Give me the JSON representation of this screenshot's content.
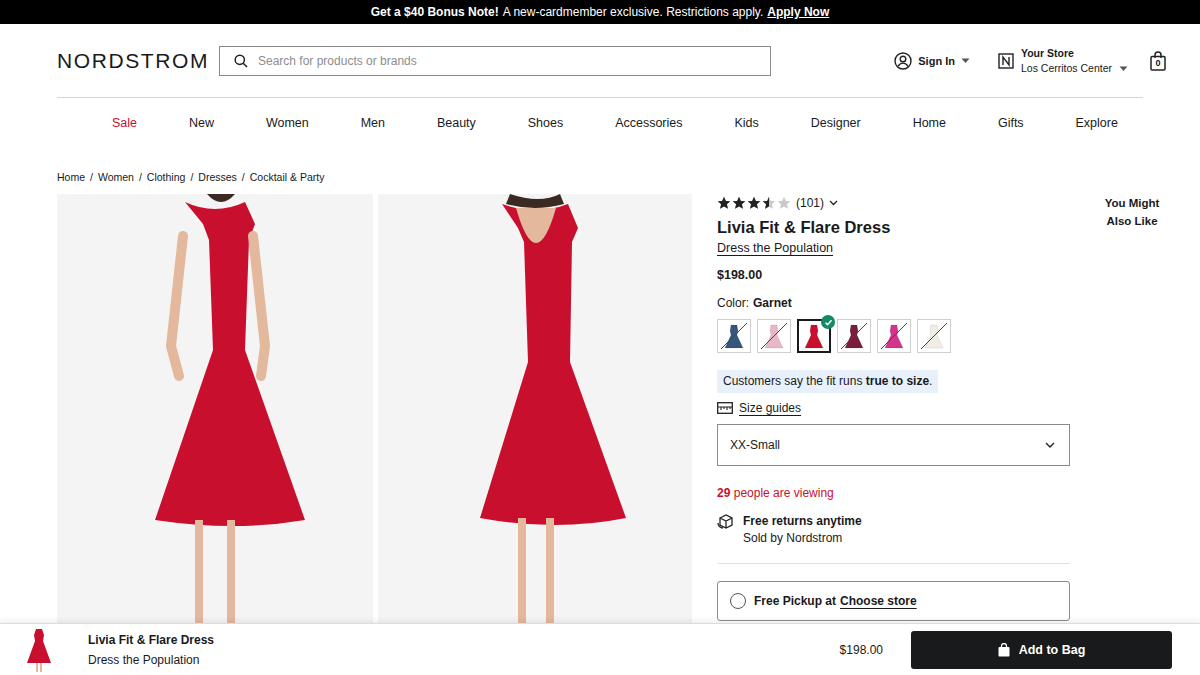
{
  "promo": {
    "headline": "Get a $40 Bonus Note!",
    "text": "A new-cardmember exclusive. Restrictions apply.",
    "link": "Apply Now"
  },
  "header": {
    "logo": "NORDSTROM",
    "search_placeholder": "Search for products or brands",
    "sign_in": "Sign In",
    "store_label": "Your Store",
    "store_name": "Los Cerritos Center",
    "bag_count": "0"
  },
  "nav": [
    {
      "label": "Sale",
      "highlight": true
    },
    {
      "label": "New",
      "highlight": false
    },
    {
      "label": "Women",
      "highlight": false
    },
    {
      "label": "Men",
      "highlight": false
    },
    {
      "label": "Beauty",
      "highlight": false
    },
    {
      "label": "Shoes",
      "highlight": false
    },
    {
      "label": "Accessories",
      "highlight": false
    },
    {
      "label": "Kids",
      "highlight": false
    },
    {
      "label": "Designer",
      "highlight": false
    },
    {
      "label": "Home",
      "highlight": false
    },
    {
      "label": "Gifts",
      "highlight": false
    },
    {
      "label": "Explore",
      "highlight": false
    }
  ],
  "breadcrumb": {
    "items": [
      "Home",
      "Women",
      "Clothing",
      "Dresses",
      "Cocktail & Party"
    ],
    "separator": "/"
  },
  "product": {
    "rating": {
      "stars": 3.5,
      "count": "(101)"
    },
    "title": "Livia Fit & Flare Dress",
    "brand": "Dress the Population",
    "price": "$198.00",
    "color_label": "Color:",
    "color_name": "Garnet",
    "swatches": [
      {
        "color": "#35577a",
        "selected": false,
        "available": false
      },
      {
        "color": "#e9b7c9",
        "selected": false,
        "available": false
      },
      {
        "color": "#c8102e",
        "selected": true,
        "available": true
      },
      {
        "color": "#7a1e3e",
        "selected": false,
        "available": false
      },
      {
        "color": "#d4358c",
        "selected": false,
        "available": false
      },
      {
        "color": "#f1ede4",
        "selected": false,
        "available": false
      }
    ],
    "fit_note": {
      "prefix": "Customers say the fit runs",
      "emphasis": "true to size",
      "suffix": "."
    },
    "size_guides": "Size guides",
    "size_value": "XX-Small",
    "viewing": {
      "count": "29",
      "text": "people are viewing"
    },
    "returns": {
      "title": "Free returns anytime",
      "subtitle": "Sold by Nordstrom"
    },
    "pickup": {
      "prefix": "Free Pickup at",
      "link": "Choose store",
      "selected": false
    }
  },
  "recommendations": {
    "title": "You Might Also Like"
  },
  "sticky_bar": {
    "title": "Livia Fit & Flare Dress",
    "brand": "Dress the Population",
    "price": "$198.00",
    "button": "Add to Bag"
  }
}
